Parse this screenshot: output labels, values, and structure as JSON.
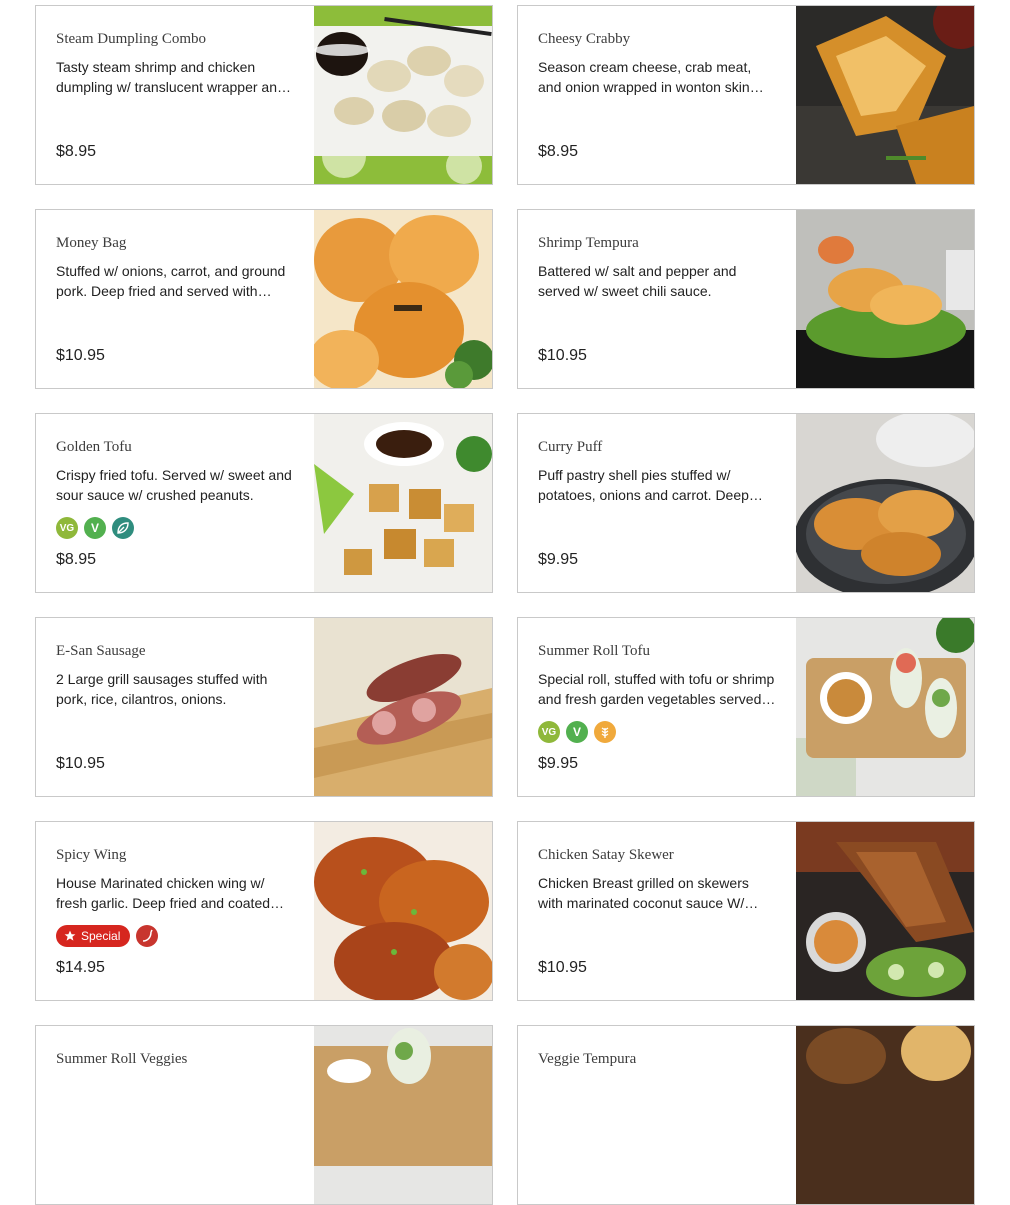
{
  "menu": {
    "items": [
      {
        "name": "Steam Dumpling Combo",
        "description": "Tasty steam shrimp and chicken dumpling w/ translucent wrapper and dipping sauce.",
        "price": "$8.95",
        "badges": [],
        "photo": "dumpling-photo"
      },
      {
        "name": "Cheesy Crabby",
        "description": "Season cream cheese, crab meat, and onion wrapped in wonton skin and deep fried.",
        "price": "$8.95",
        "badges": [],
        "photo": "crab-rangoon-photo"
      },
      {
        "name": "Money Bag",
        "description": "Stuffed w/ onions, carrot, and ground pork. Deep fried and served with sweet chili sauce.",
        "price": "$10.95",
        "badges": [],
        "photo": "money-bag-photo"
      },
      {
        "name": "Shrimp Tempura",
        "description": "Battered w/ salt and pepper and served w/ sweet chili sauce.",
        "price": "$10.95",
        "badges": [],
        "photo": "shrimp-tempura-photo"
      },
      {
        "name": "Golden Tofu",
        "description": "Crispy fried tofu. Served w/ sweet and sour sauce w/ crushed peanuts.",
        "price": "$8.95",
        "badges": [
          "VG",
          "V",
          "leaf"
        ],
        "photo": "tofu-photo"
      },
      {
        "name": "Curry Puff",
        "description": "Puff pastry shell pies stuffed w/ potatoes, onions and carrot. Deep fried and served with cucumber salad.",
        "price": "$9.95",
        "badges": [],
        "photo": "curry-puff-photo"
      },
      {
        "name": "E-San Sausage",
        "description": "2 Large grill sausages stuffed with pork, rice, cilantros, onions.",
        "price": "$10.95",
        "badges": [],
        "photo": "sausage-photo"
      },
      {
        "name": "Summer Roll Tofu",
        "description": "Special roll, stuffed with tofu or shrimp and fresh garden vegetables served with peanut sauce.",
        "price": "$9.95",
        "badges": [
          "VG",
          "V",
          "GF"
        ],
        "photo": "summer-roll-photo"
      },
      {
        "name": "Spicy Wing",
        "description": "House Marinated chicken wing w/ fresh garlic. Deep fried and coated with spicy sauce.",
        "price": "$14.95",
        "badges": [
          "Special",
          "spicy"
        ],
        "photo": "wing-photo"
      },
      {
        "name": "Chicken Satay Skewer",
        "description": "Chicken Breast grilled on skewers with marinated coconut sauce W/ peanut sauce and cucumber salad.",
        "price": "$10.95",
        "badges": [],
        "photo": "satay-photo"
      },
      {
        "name": "Summer Roll Veggies",
        "description": "",
        "price": "",
        "badges": [],
        "photo": "summer-roll-veggie-photo"
      },
      {
        "name": "Veggie Tempura",
        "description": "",
        "price": "",
        "badges": [],
        "photo": "veggie-tempura-photo"
      }
    ]
  },
  "badge_labels": {
    "vg": "VG",
    "v": "V",
    "special": "Special"
  },
  "colors": {
    "border": "#c9c9c9",
    "special": "#d6261f",
    "vegan": "#8fb83a",
    "vegetarian": "#52b04f",
    "organic": "#2f8d7e",
    "gluten_free": "#f0a93c",
    "spicy": "#c8352e"
  }
}
